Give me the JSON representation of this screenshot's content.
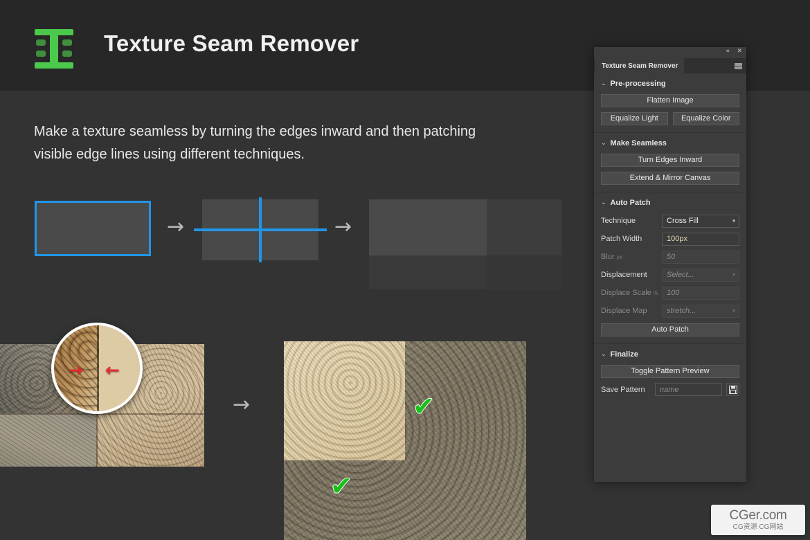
{
  "header": {
    "title": "Texture Seam Remover",
    "logo_icon": "i-beam-logo-icon",
    "logo_color": "#4cc94c"
  },
  "intro": {
    "text": "Make a texture seamless by turning the edges inward and then patching visible edge lines using different techniques."
  },
  "diagram": {
    "arrow_glyph": "→",
    "accent_color": "#2196e8",
    "steps": [
      {
        "name": "original-texture-bordered"
      },
      {
        "name": "edges-turned-inward-crosshair"
      },
      {
        "name": "tiled-seamless-result"
      }
    ]
  },
  "comparison": {
    "before": {
      "name": "texture-with-visible-seam",
      "magnifier_label": "seam-closeup",
      "left_arrow": "→",
      "right_arrow": "←",
      "arrow_color": "#e8282d"
    },
    "arrow_glyph": "→",
    "after": {
      "name": "patched-seamless-texture",
      "check_glyph": "✔",
      "check_color": "#18c018",
      "check_count": 2
    }
  },
  "panel": {
    "titlebar": {
      "collapse_icon": "«",
      "close_icon": "✕"
    },
    "tab_label": "Texture Seam Remover",
    "menu_icon": "panel-menu-icon",
    "sections": [
      {
        "id": "pre-processing",
        "title": "Pre-processing",
        "chevron": "⌄",
        "buttons": [
          {
            "label": "Flatten Image",
            "name": "flatten-image-button"
          },
          {
            "label": "Equalize Light",
            "name": "equalize-light-button"
          },
          {
            "label": "Equalize Color",
            "name": "equalize-color-button"
          }
        ]
      },
      {
        "id": "make-seamless",
        "title": "Make Seamless",
        "chevron": "⌄",
        "buttons": [
          {
            "label": "Turn Edges Inward",
            "name": "turn-edges-inward-button"
          },
          {
            "label": "Extend & Mirror Canvas",
            "name": "extend-mirror-canvas-button"
          }
        ]
      },
      {
        "id": "auto-patch",
        "title": "Auto Patch",
        "chevron": "⌄",
        "fields": [
          {
            "label": "Technique",
            "unit": "",
            "value": "Cross Fill",
            "type": "select",
            "disabled": false,
            "placeholder": false
          },
          {
            "label": "Patch Width",
            "unit": "",
            "value": "100px",
            "type": "text",
            "disabled": false,
            "placeholder": false
          },
          {
            "label": "Blur",
            "unit": "px",
            "value": "50",
            "type": "text",
            "disabled": true,
            "placeholder": true
          },
          {
            "label": "Displacement",
            "unit": "",
            "value": "Select...",
            "type": "select",
            "disabled": true,
            "placeholder": true
          },
          {
            "label": "Displace Scale",
            "unit": "%",
            "value": "100",
            "type": "text",
            "disabled": true,
            "placeholder": true
          },
          {
            "label": "Displace Map",
            "unit": "",
            "value": "stretch...",
            "type": "select",
            "disabled": true,
            "placeholder": true
          }
        ],
        "action_button": {
          "label": "Auto Patch",
          "name": "auto-patch-button"
        }
      },
      {
        "id": "finalize",
        "title": "Finalize",
        "chevron": "⌄",
        "buttons": [
          {
            "label": "Toggle Pattern Preview",
            "name": "toggle-pattern-preview-button"
          }
        ],
        "save_row": {
          "label": "Save Pattern",
          "placeholder": "name",
          "value": "",
          "save_icon": "💾"
        }
      }
    ]
  },
  "watermark": {
    "main": "CGer.com",
    "sub": "CG资源 CG网站"
  }
}
